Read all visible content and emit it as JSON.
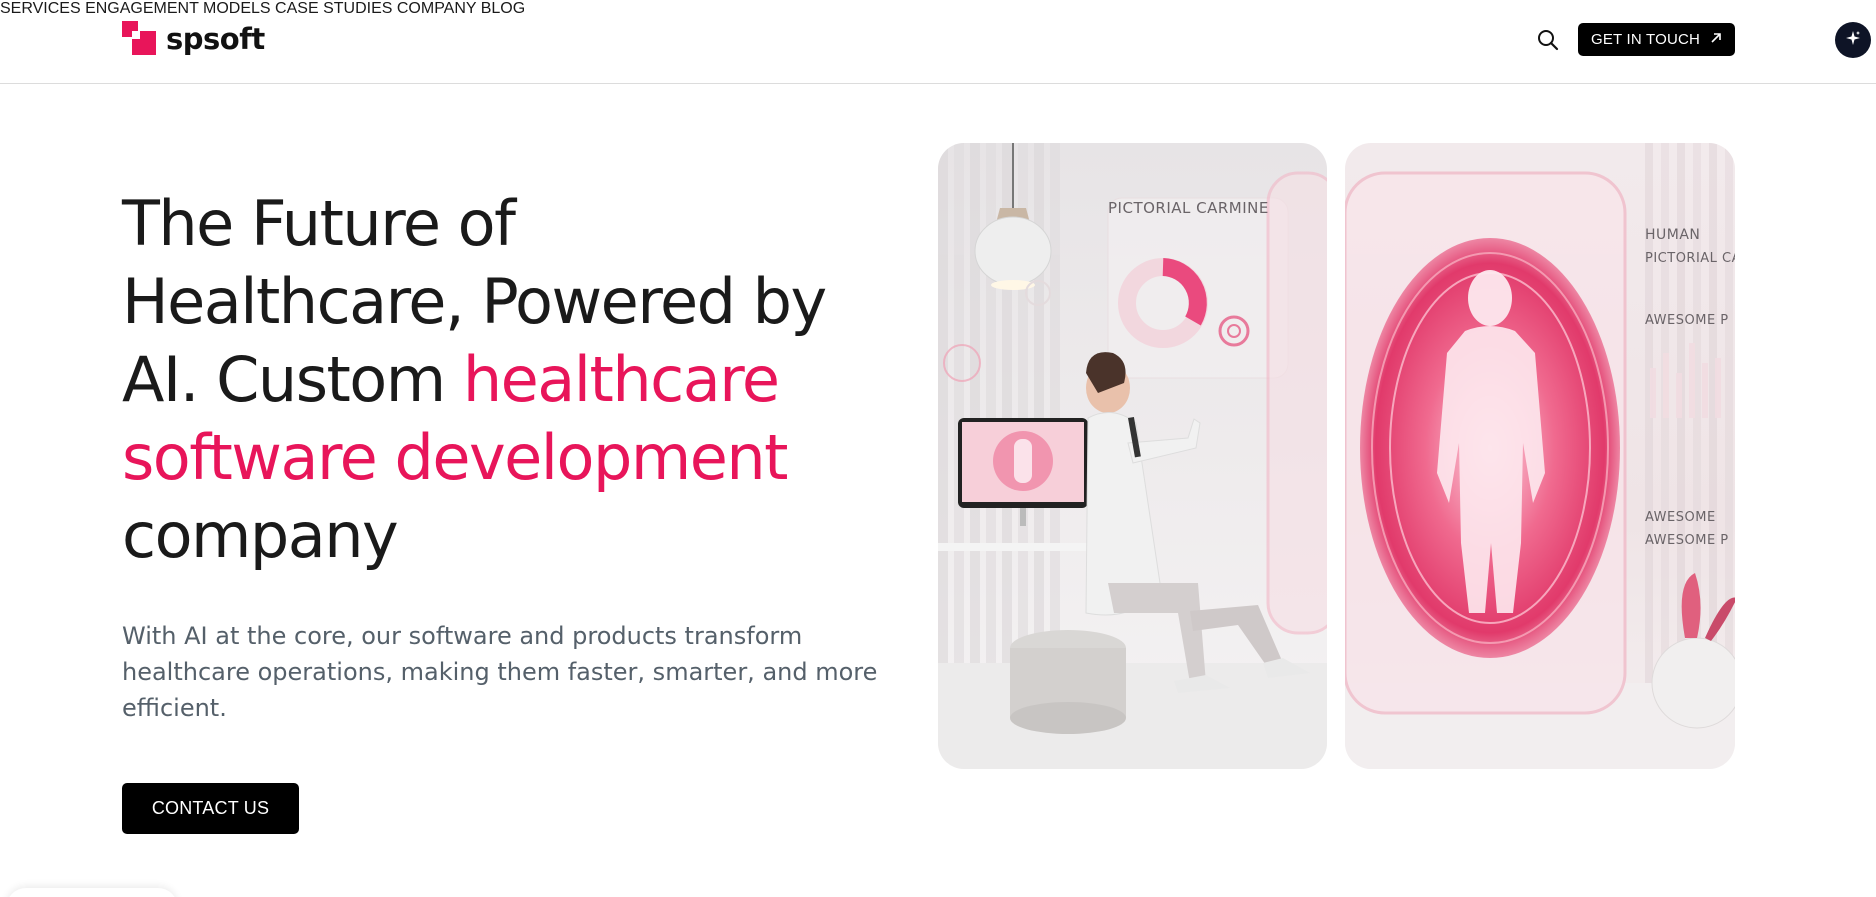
{
  "brand": {
    "name": "spsoft",
    "accent_color": "#e8155a"
  },
  "nav": {
    "items": [
      {
        "label": "SERVICES"
      },
      {
        "label": "ENGAGEMENT MODELS"
      },
      {
        "label": "CASE STUDIES"
      },
      {
        "label": "COMPANY"
      },
      {
        "label": "BLOG"
      }
    ],
    "search_icon": "search-icon",
    "cta_label": "GET IN TOUCH",
    "cta_icon": "arrow-up-right-icon",
    "ai_icon": "sparkle-icon"
  },
  "hero": {
    "title_line1": "The Future of",
    "title_line2": "Healthcare, Powered by",
    "title_line3_plain": "AI. Custom ",
    "title_line3_accent": "healthcare",
    "title_line4_accent": "software development",
    "title_line5": "company",
    "subtitle": "With AI at the core, our software and products transform healthcare operations, making them faster, smarter, and more efficient.",
    "button_label": "CONTACT US"
  },
  "images": {
    "left_label": "PICTORIAL CARMINE",
    "right_labels": [
      "HUMAN",
      "PICTORIAL CA",
      "AWESOME P",
      "AWESOME",
      "AWESOME P"
    ]
  }
}
